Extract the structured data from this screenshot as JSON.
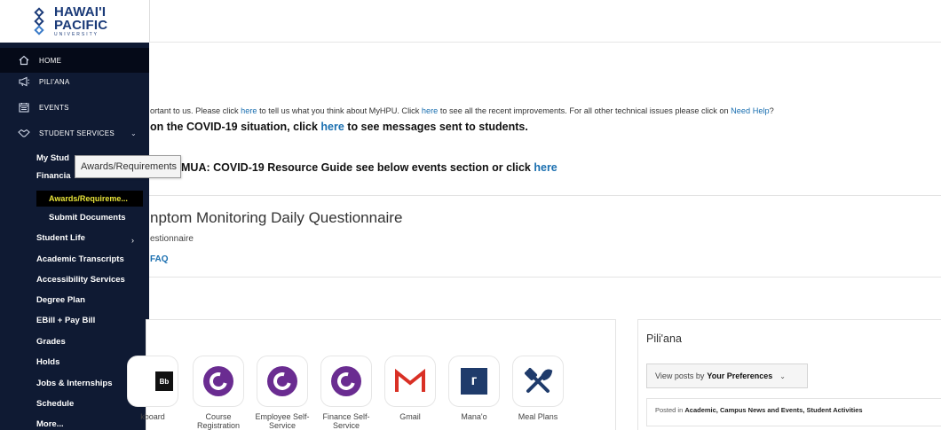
{
  "logo": {
    "line1": "HAWAI'I",
    "line2": "PACIFIC",
    "line3": "UNIVERSITY"
  },
  "sidebar": {
    "home": "HOME",
    "piliana": "PILI'ANA",
    "events": "EVENTS",
    "student_services": "STUDENT SERVICES",
    "items": [
      "My Stud",
      "Financia",
      "Awards/Requireme...",
      "Submit Documents",
      "Student Life",
      "Academic Transcripts",
      "Accessibility Services",
      "Degree Plan",
      "EBill + Pay Bill",
      "Grades",
      "Holds",
      "Jobs & Internships",
      "Schedule",
      "More..."
    ]
  },
  "tooltip": "Awards/Requirements",
  "notice": {
    "feedback_a": "ortant to us. Please click ",
    "link1": "here",
    "feedback_b": " to tell us what you think about MyHPU. Click ",
    "link2": "here",
    "feedback_c": " to see all the recent improvements. For all other technical issues please click on ",
    "link3": "Need Help",
    "feedback_d": "?",
    "covid_a": "on the COVID-19 situation, click ",
    "covid_link": "here",
    "covid_b": " to see messages sent to students.",
    "guide_a": "MUA: COVID-19 Resource Guide see below events section or click ",
    "guide_link": "here"
  },
  "questionnaire": {
    "title": "nptom Monitoring Daily Questionnaire",
    "subtitle": "estionnaire",
    "faq": "FAQ"
  },
  "apps": [
    {
      "label": "kboard",
      "icon": "blackboard-icon"
    },
    {
      "label": "Course Registration",
      "icon": "ellucian-icon"
    },
    {
      "label": "Employee Self-Service",
      "icon": "ellucian-icon"
    },
    {
      "label": "Finance Self-Service",
      "icon": "ellucian-icon"
    },
    {
      "label": "Gmail",
      "icon": "gmail-icon"
    },
    {
      "label": "Mana'o",
      "icon": "manao-icon"
    },
    {
      "label": "Meal Plans",
      "icon": "meal-plans-icon"
    }
  ],
  "piliana": {
    "title": "Pili'ana",
    "view_by": "View posts by",
    "preference": "Your Preferences",
    "posted_in": "Posted in",
    "categories": "Academic, Campus News and Events, Student Activities"
  },
  "colors": {
    "sidebar_bg": "#0f1a33",
    "active_text": "#e8e43a",
    "link": "#1a6fb0",
    "ellucian_purple": "#6a2c91",
    "gmail_red": "#d93025"
  }
}
